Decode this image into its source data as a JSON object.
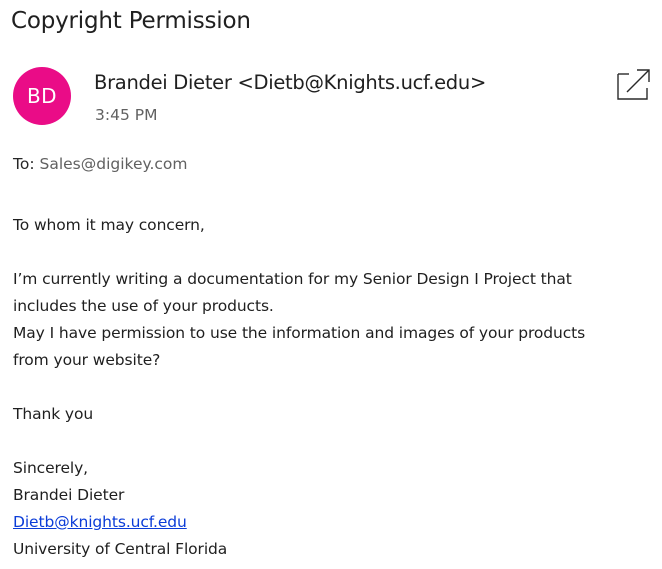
{
  "subject": "Copyright Permission",
  "sender": {
    "initials": "BD",
    "display": "Brandei Dieter <Dietb@Knights.ucf.edu>",
    "avatar_color": "#ea0c87"
  },
  "time": "3:45 PM",
  "recipients": {
    "label": "To:",
    "to": "Sales@digikey.com"
  },
  "icons": {
    "popout": "open-in-new-window-icon"
  },
  "body": {
    "greeting": "To whom it may concern,",
    "paragraph_line1": "I’m currently writing a documentation for my Senior Design I Project that",
    "paragraph_line2": "includes the use of your products.",
    "paragraph_line3": "May I have permission to use the information and images of your products",
    "paragraph_line4": "from your website?",
    "thanks": "Thank you",
    "closing": "Sincerely,",
    "signature_name": "Brandei Dieter",
    "signature_email": "Dietb@knights.ucf.edu",
    "signature_org": "University of Central Florida"
  },
  "colors": {
    "link": "#0b3cd8"
  }
}
